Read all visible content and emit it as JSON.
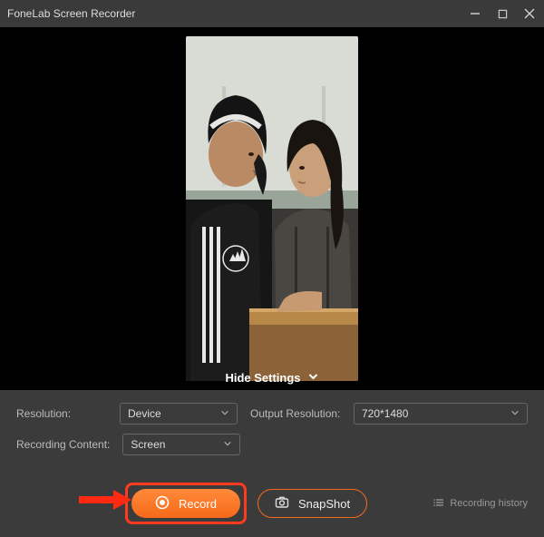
{
  "titlebar": {
    "title": "FoneLab Screen Recorder"
  },
  "preview": {
    "hide_settings_label": "Hide Settings"
  },
  "settings": {
    "resolution_label": "Resolution:",
    "resolution_value": "Device",
    "output_resolution_label": "Output Resolution:",
    "output_resolution_value": "720*1480",
    "recording_content_label": "Recording Content:",
    "recording_content_value": "Screen"
  },
  "buttons": {
    "record_label": "Record",
    "snapshot_label": "SnapShot",
    "history_label": "Recording history"
  }
}
